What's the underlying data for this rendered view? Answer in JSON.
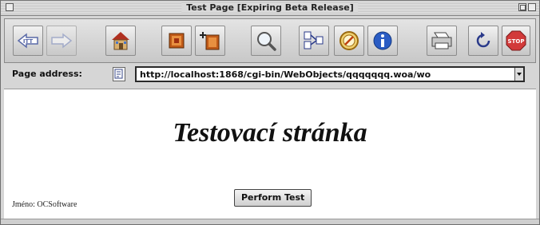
{
  "window": {
    "title": "Test Page [Expiring Beta Release]"
  },
  "toolbar": {
    "buttons": [
      {
        "id": "back",
        "icon": "back-arrow-icon",
        "label": "←"
      },
      {
        "id": "forward",
        "icon": "forward-arrow-icon",
        "label": "→"
      },
      {
        "id": "home",
        "icon": "home-icon"
      },
      {
        "id": "bookmarks",
        "icon": "bookmark-icon"
      },
      {
        "id": "add-bookmark",
        "icon": "add-bookmark-icon"
      },
      {
        "id": "search",
        "icon": "search-icon"
      },
      {
        "id": "history",
        "icon": "history-icon"
      },
      {
        "id": "preferences",
        "icon": "compass-icon"
      },
      {
        "id": "info",
        "icon": "info-icon"
      },
      {
        "id": "print",
        "icon": "print-icon"
      },
      {
        "id": "reload",
        "icon": "reload-icon"
      },
      {
        "id": "stop",
        "icon": "stop-icon",
        "label": "STOP"
      }
    ],
    "colors": {
      "home_roof": "#b03020",
      "bookmark": "#c05a18",
      "info": "#2a5cc4",
      "stop": "#d23a3a"
    }
  },
  "address": {
    "label": "Page address:",
    "value": "http://localhost:1868/cgi-bin/WebObjects/qqqqqqq.woa/wo"
  },
  "page": {
    "heading": "Testovací stránka",
    "footer_text": "Jméno: OCSoftware",
    "perform_button": "Perform Test"
  }
}
